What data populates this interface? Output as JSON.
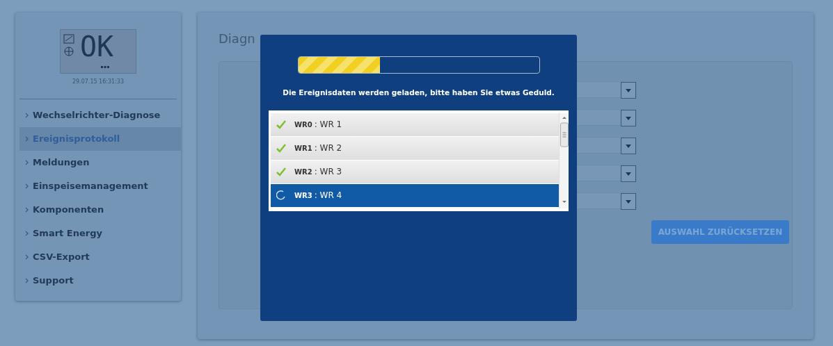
{
  "sidebar": {
    "display": {
      "text": "OK",
      "timestamp": "29.07.15 16:31:33"
    },
    "items": [
      {
        "label": "Wechselrichter-Diagnose",
        "selected": false
      },
      {
        "label": "Ereignisprotokoll",
        "selected": true
      },
      {
        "label": "Meldungen",
        "selected": false
      },
      {
        "label": "Einspeisemanagement",
        "selected": false
      },
      {
        "label": "Komponenten",
        "selected": false
      },
      {
        "label": "Smart Energy",
        "selected": false
      },
      {
        "label": "CSV-Export",
        "selected": false
      },
      {
        "label": "Support",
        "selected": false
      }
    ]
  },
  "main": {
    "title": "Diagn",
    "button": "AUSWAHL ZURÜCKSETZEN"
  },
  "modal": {
    "progress": {
      "level": 0.34
    },
    "message": "Die Ereignisdaten werden geladen, bitte haben Sie etwas Geduld.",
    "items": [
      {
        "id": "WR0",
        "separator": ":",
        "name": "WR 1",
        "kind": "done",
        "selected": false
      },
      {
        "id": "WR1",
        "separator": ":",
        "name": "WR 2",
        "kind": "done",
        "selected": false
      },
      {
        "id": "WR2",
        "separator": ":",
        "name": "WR 3",
        "kind": "done",
        "selected": false
      },
      {
        "id": "WR3",
        "separator": ":",
        "name": "WR 4",
        "kind": "loading",
        "selected": true
      }
    ]
  }
}
